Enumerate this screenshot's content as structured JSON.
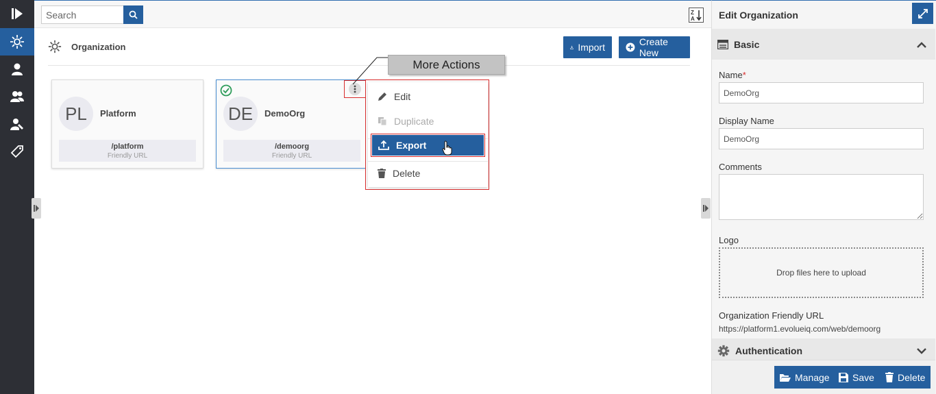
{
  "search": {
    "placeholder": "Search"
  },
  "page": {
    "title": "Organization"
  },
  "toolbar": {
    "import_label": "Import",
    "create_label": "Create New"
  },
  "cards": [
    {
      "initials": "PL",
      "name": "Platform",
      "url": "/platform",
      "url_label": "Friendly URL"
    },
    {
      "initials": "DE",
      "name": "DemoOrg",
      "url": "/demoorg",
      "url_label": "Friendly URL"
    }
  ],
  "menu": {
    "items": [
      {
        "label": "Edit",
        "icon": "pencil-icon"
      },
      {
        "label": "Duplicate",
        "icon": "copy-icon",
        "disabled": true
      },
      {
        "label": "Export",
        "icon": "upload-icon",
        "highlighted": true
      },
      {
        "label": "Delete",
        "icon": "trash-icon"
      }
    ]
  },
  "callout": {
    "text": "More Actions"
  },
  "panel": {
    "title": "Edit Organization",
    "basic_section": "Basic",
    "name_label": "Name",
    "name_value": "DemoOrg",
    "display_name_label": "Display Name",
    "display_name_value": "DemoOrg",
    "comments_label": "Comments",
    "logo_label": "Logo",
    "dropzone_text": "Drop files here to upload",
    "friendly_url_label": "Organization Friendly URL",
    "friendly_url_value": "https://platform1.evolueiq.com/web/demoorg",
    "auth_section": "Authentication",
    "manage_label": "Manage",
    "save_label": "Save",
    "delete_label": "Delete"
  },
  "colors": {
    "accent": "#255f9e",
    "rail": "#2d2f35",
    "highlight_border": "#d82b2b",
    "success": "#2e9c5a"
  }
}
